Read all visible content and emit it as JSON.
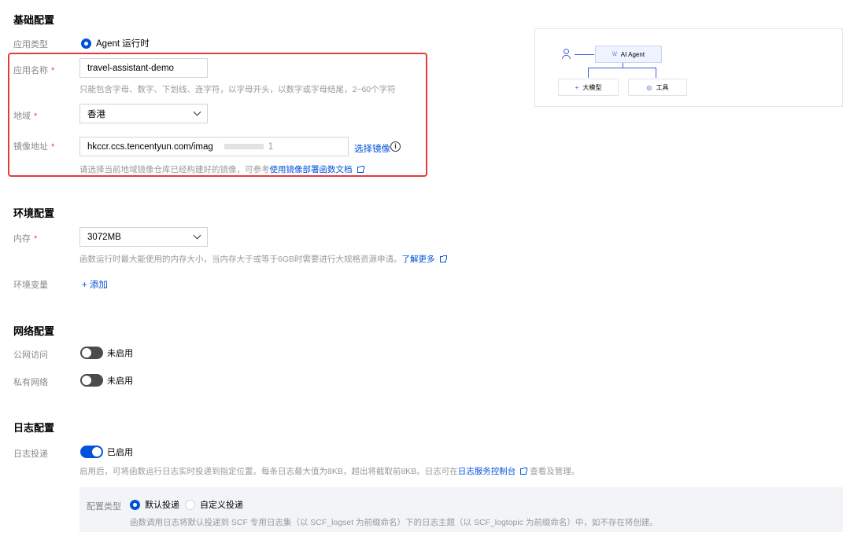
{
  "basic": {
    "title": "基础配置",
    "app_type_label": "应用类型",
    "app_type_option": "Agent 运行时",
    "app_name_label": "应用名称",
    "app_name_value": "travel-assistant-demo",
    "app_name_help": "只能包含字母、数字、下划线、连字符，以字母开头，以数字或字母结尾，2~60个字符",
    "region_label": "地域",
    "region_value": "香港",
    "image_label": "镜像地址",
    "image_value": "hkccr.ccs.tencentyun.com/imag",
    "image_value_tail": "1",
    "select_image_label": "选择镜像",
    "info_icon_glyph": "i",
    "image_help_prefix": "请选择当前地域镜像仓库已经构建好的镜像，可参考",
    "image_help_link": "使用镜像部署函数文档",
    "required_mark": "*"
  },
  "diagram": {
    "agent_label": "AI Agent",
    "agent_icon_glyph": "\\\\/",
    "model_label": "大模型",
    "model_icon_glyph": "+",
    "tool_label": "工具",
    "tool_icon_glyph": "◎"
  },
  "env": {
    "title": "环境配置",
    "memory_label": "内存",
    "memory_value": "3072MB",
    "memory_help_prefix": "函数运行时最大能使用的内存大小，当内存大于或等于6GB时需要进行大规格资源申请。",
    "memory_help_link": "了解更多",
    "env_var_label": "环境变量",
    "add_label": "+ 添加"
  },
  "network": {
    "title": "网络配置",
    "public_label": "公网访问",
    "public_status": "未启用",
    "private_label": "私有网络",
    "private_status": "未启用"
  },
  "log": {
    "title": "日志配置",
    "delivery_label": "日志投递",
    "delivery_status": "已启用",
    "help_prefix": "启用后，可将函数运行日志实时投递到指定位置。每条日志最大值为8KB，超出将截取前8KB。日志可在",
    "help_link": "日志服务控制台",
    "help_suffix": "查看及管理。",
    "config_type_label": "配置类型",
    "option_default": "默认投递",
    "option_custom": "自定义投递",
    "config_help": "函数调用日志将默认投递到 SCF 专用日志集（以 SCF_logset 为前缀命名）下的日志主题（以 SCF_logtopic 为前缀命名）中，如不存在将创建。"
  },
  "colors": {
    "accent": "#0052d9",
    "required": "#e54545",
    "highlight_border": "#e53a3a"
  }
}
